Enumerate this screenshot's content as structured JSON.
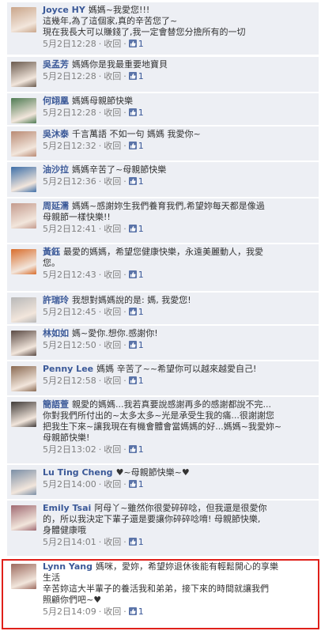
{
  "comments": [
    {
      "author": "Joyce HY",
      "lines": [
        "媽媽~我愛您!!!",
        "這幾年,為了這個家,真的辛苦您了~",
        "現在我長大可以賺錢了,我一定會替您分擔所有的一切"
      ],
      "time": "5月2日12:28",
      "action": "收回",
      "likes": "1"
    },
    {
      "author": "吳孟芳",
      "lines": [
        "媽媽你是我最重要地寶貝"
      ],
      "time": "5月2日12:28",
      "action": "收回",
      "likes": "1"
    },
    {
      "author": "何翊凰",
      "lines": [
        "媽媽母親節快樂"
      ],
      "time": "5月2日12:28",
      "action": "收回",
      "likes": "1"
    },
    {
      "author": "吳沐泰",
      "lines": [
        "千言萬語 不如一句 媽媽 我愛你~"
      ],
      "time": "5月2日12:32",
      "action": "收回",
      "likes": "1"
    },
    {
      "author": "油沙拉",
      "lines": [
        "媽媽辛苦了~母親節快樂"
      ],
      "time": "5月2日12:36",
      "action": "收回",
      "likes": "1"
    },
    {
      "author": "周延濡",
      "lines": [
        "媽媽~感謝妳生我們養育我們,希望妳每天都是像過",
        "母親節一樣快樂!!"
      ],
      "time": "5月2日12:41",
      "action": "收回",
      "likes": "1"
    },
    {
      "author": "黃鈺",
      "lines": [
        "最愛的媽媽，希望您健康快樂，永遠美麗動人，我愛",
        "您。"
      ],
      "time": "5月2日12:43",
      "action": "收回",
      "likes": "1"
    },
    {
      "author": "許瑞玲",
      "lines": [
        "我想對媽媽說的是: 媽, 我愛您!"
      ],
      "time": "5月2日12:45",
      "action": "收回",
      "likes": "1"
    },
    {
      "author": "林如如",
      "lines": [
        "媽~愛你.想你.感謝你!"
      ],
      "time": "5月2日12:50",
      "action": "收回",
      "likes": "1"
    },
    {
      "author": "Penny Lee",
      "lines": [
        "媽媽 辛苦了~~希望你可以越來越愛自己!"
      ],
      "time": "5月2日12:58",
      "action": "收回",
      "likes": "1"
    },
    {
      "author": "簡語萱",
      "lines": [
        "親愛的媽媽...我若真要說感謝再多的感謝都說不完...",
        "你對我們所付出的~太多太多~光是承受生我的痛...很謝謝您",
        "把我生下來~讓我現在有機會體會當媽媽的好...媽媽~我愛妳~",
        "母親節快樂!"
      ],
      "time": "5月2日13:02",
      "action": "收回",
      "likes": "1"
    },
    {
      "author": "Lu Ting Cheng",
      "lines": [
        "♥~母親節快樂~♥"
      ],
      "time": "5月2日14:00",
      "action": "收回",
      "likes": "1"
    },
    {
      "author": "Emily Tsai",
      "lines": [
        "阿母丫~雖然你很愛碎碎唸，但我還是很愛你",
        "的，所以我決定下輩子還是要讓你碎碎唸唷! 母親節快樂,",
        "身體健康哦"
      ],
      "time": "5月2日14:01",
      "action": "收回",
      "likes": "1"
    },
    {
      "author": "Lynn Yang",
      "lines": [
        "媽咪，愛妳，希望妳退休後能有輕鬆開心的享樂",
        "生活",
        "辛苦妳這大半輩子的養活我和弟弟，接下來的時間就讓我們",
        "照顧你們吧~♥"
      ],
      "time": "5月2日14:09",
      "action": "收回",
      "likes": "1"
    }
  ],
  "colors": {
    "author": "#3b5998",
    "meta": "#808080",
    "row_bg": "#edeff4",
    "highlight": "#e0201a"
  }
}
